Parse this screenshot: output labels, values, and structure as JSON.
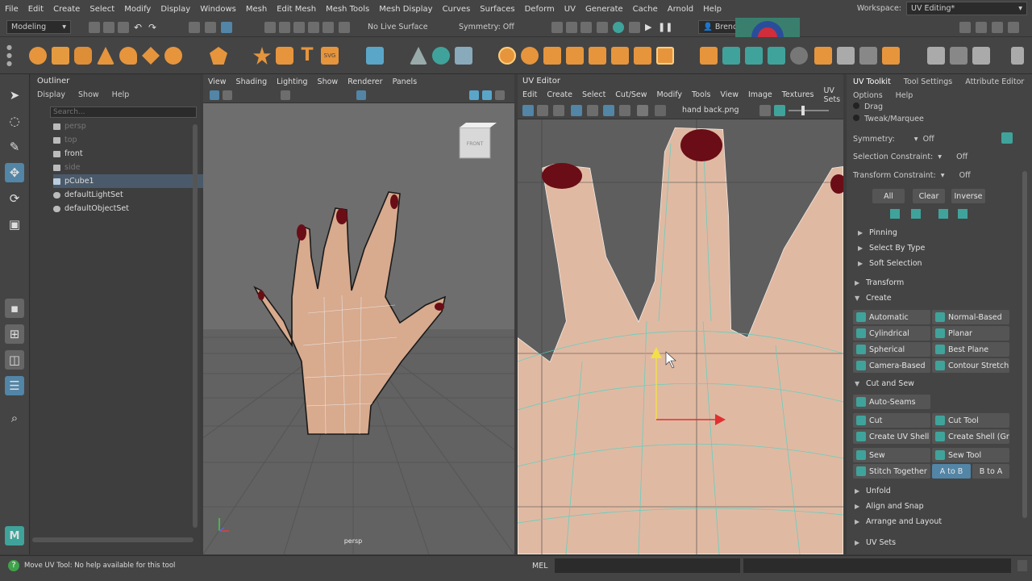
{
  "menubar": {
    "items": [
      "File",
      "Edit",
      "Create",
      "Select",
      "Modify",
      "Display",
      "Windows",
      "Mesh",
      "Edit Mesh",
      "Mesh Tools",
      "Mesh Display",
      "Curves",
      "Surfaces",
      "Deform",
      "UV",
      "Generate",
      "Cache",
      "Arnold",
      "Help"
    ],
    "workspace_label": "Workspace:",
    "workspace_value": "UV Editing*"
  },
  "status": {
    "mode": "Modeling",
    "live_surface": "No Live Surface",
    "symmetry": "Symmetry: Off",
    "user": "Brenda Hernan..."
  },
  "outliner": {
    "title": "Outliner",
    "menu": [
      "Display",
      "Show",
      "Help"
    ],
    "search_placeholder": "Search...",
    "items": [
      {
        "label": "persp",
        "dim": true
      },
      {
        "label": "top",
        "dim": true
      },
      {
        "label": "front",
        "dim": false
      },
      {
        "label": "side",
        "dim": true
      },
      {
        "label": "pCube1",
        "dim": false,
        "selected": true
      },
      {
        "label": "defaultLightSet",
        "dim": false
      },
      {
        "label": "defaultObjectSet",
        "dim": false
      }
    ]
  },
  "viewport": {
    "menu": [
      "View",
      "Shading",
      "Lighting",
      "Show",
      "Renderer",
      "Panels"
    ],
    "camera_label": "persp",
    "viewcube_label": "FRONT"
  },
  "uveditor": {
    "title": "UV Editor",
    "menu": [
      "Edit",
      "Create",
      "Select",
      "Cut/Sew",
      "Modify",
      "Tools",
      "View",
      "Image",
      "Textures",
      "UV Sets"
    ],
    "texture_name": "hand back.png"
  },
  "toolkit": {
    "tabs": [
      "UV Toolkit",
      "Tool Settings",
      "Attribute Editor"
    ],
    "menu": [
      "Options",
      "Help"
    ],
    "drag": "Drag",
    "tweak": "Tweak/Marquee",
    "symmetry_label": "Symmetry:",
    "symmetry_value": "Off",
    "selection_constraint_label": "Selection Constraint:",
    "selection_constraint_value": "Off",
    "transform_constraint_label": "Transform Constraint:",
    "transform_constraint_value": "Off",
    "all": "All",
    "clear": "Clear",
    "inverse": "Inverse",
    "pinning": "Pinning",
    "select_by_type": "Select By Type",
    "soft_selection": "Soft Selection",
    "transform": "Transform",
    "create": "Create",
    "create_buttons": [
      "Automatic",
      "Normal-Based",
      "Cylindrical",
      "Planar",
      "Spherical",
      "Best Plane",
      "Camera-Based",
      "Contour Stretch"
    ],
    "cut_and_sew": "Cut and Sew",
    "auto_seams": "Auto-Seams",
    "cut": "Cut",
    "cut_tool": "Cut Tool",
    "create_uv_shell": "Create UV Shell",
    "create_shell_grid": "Create Shell (Grid)",
    "sew": "Sew",
    "sew_tool": "Sew Tool",
    "stitch_together": "Stitch Together",
    "a_to_b": "A to B",
    "b_to_a": "B to A",
    "unfold": "Unfold",
    "align_and_snap": "Align and Snap",
    "arrange_and_layout": "Arrange and Layout",
    "uv_sets": "UV Sets"
  },
  "helpline": {
    "message": "Move UV Tool: No help available for this tool",
    "mel_label": "MEL"
  },
  "colors": {
    "accent_blue": "#5285a6",
    "uv_teal": "#3fa39b",
    "selected_row": "#4a5a6a"
  }
}
